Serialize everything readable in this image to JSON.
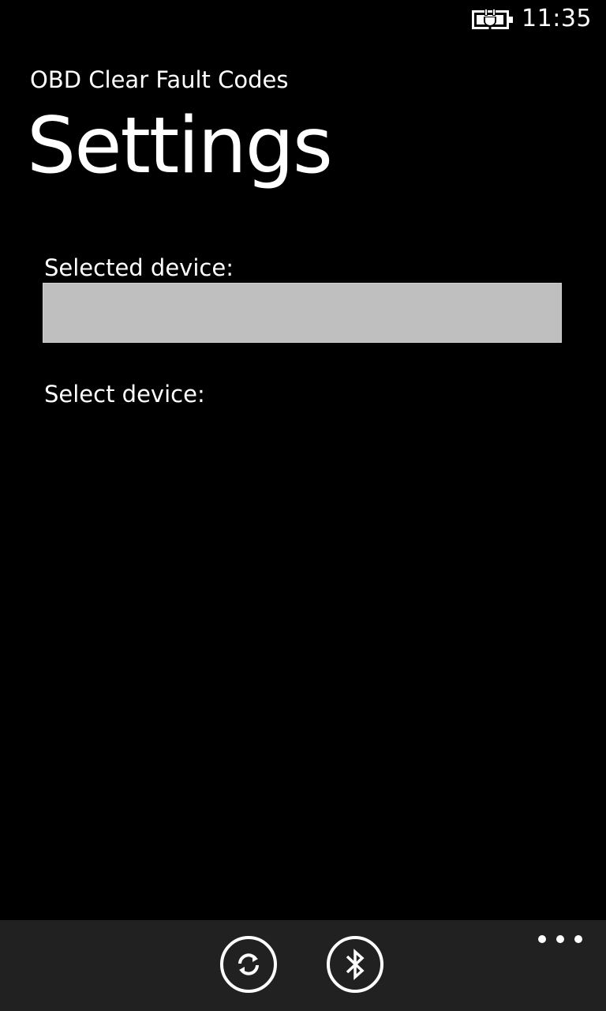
{
  "status_bar": {
    "time": "11:35",
    "battery_icon": "battery-charging-icon"
  },
  "header": {
    "app_title": "OBD Clear Fault Codes",
    "page_title": "Settings"
  },
  "settings": {
    "selected_device_label": "Selected device:",
    "selected_device_value": "",
    "select_device_label": "Select device:",
    "devices": []
  },
  "app_bar": {
    "buttons": [
      {
        "icon": "refresh-icon"
      },
      {
        "icon": "bluetooth-icon"
      }
    ],
    "more_icon": "more-icon",
    "background": "#212121"
  },
  "colors": {
    "background": "#000000",
    "foreground": "#ffffff",
    "selected_box": "#bfbfbf"
  }
}
